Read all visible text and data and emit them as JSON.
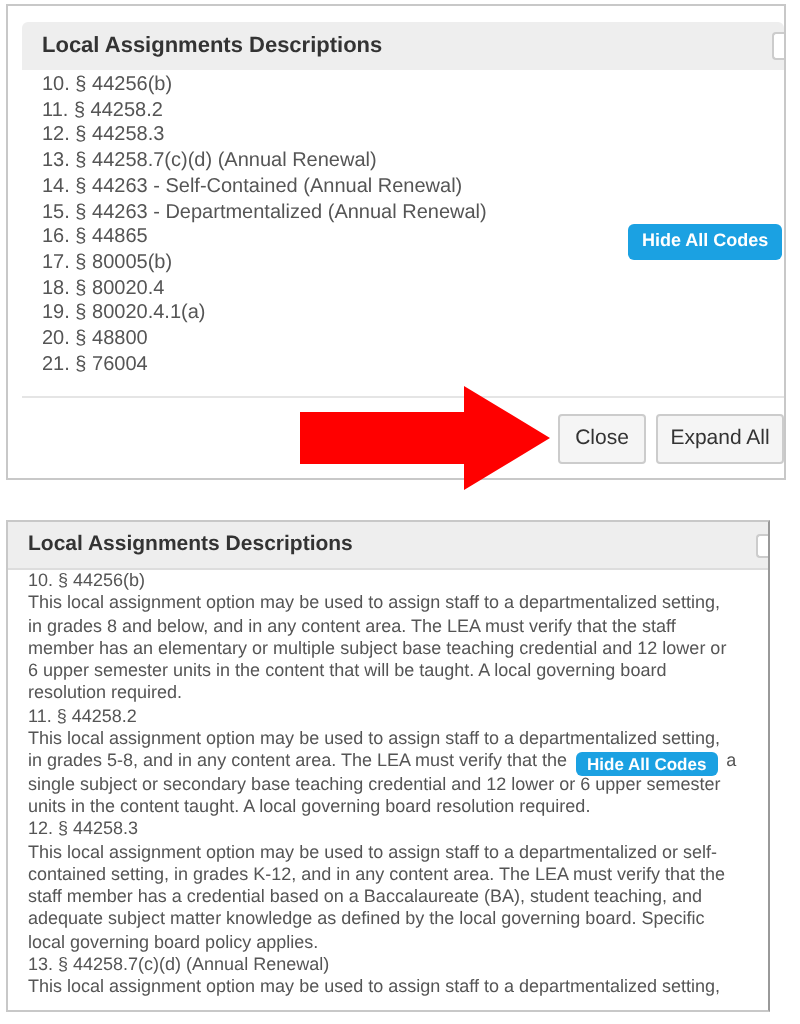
{
  "top_dialog": {
    "title": "Local Assignments Descriptions",
    "items": [
      "10. § 44256(b)",
      "11. § 44258.2",
      "12. § 44258.3",
      "13. § 44258.7(c)(d) (Annual Renewal)",
      "14. § 44263 - Self-Contained (Annual Renewal)",
      "15. § 44263 - Departmentalized (Annual Renewal)",
      "16. § 44865",
      "17. § 80005(b)",
      "18. § 80020.4",
      "19. § 80020.4.1(a)",
      "20. § 48800",
      "21. § 76004"
    ],
    "hide_button": "Hide All Codes",
    "buttons": [
      "Close",
      "Expand All"
    ]
  },
  "bottom_dialog": {
    "title": "Local Assignments Descriptions",
    "hide_button": "Hide All Codes",
    "entries": [
      {
        "heading": "10. § 44256(b)",
        "description": "This local assignment option may be used to assign staff to a departmentalized setting, in grades 8 and below, and in any content area. The LEA must verify that the staff member has an elementary or multiple subject base teaching credential and 12 lower or 6 upper semester units in the content that will be taught. A local governing board resolution required."
      },
      {
        "heading": "11. § 44258.2",
        "description": "This local assignment option may be used to assign staff to a departmentalized setting,",
        "line_before_button": "in grades 5-8, and in any content area. The LEA must verify that the",
        "line_after_button": "a",
        "description_continued": "single subject or secondary base teaching credential and 12 lower or 6 upper semester units in the content taught. A local governing board resolution required."
      },
      {
        "heading": "12. § 44258.3",
        "description": "This local assignment option may be used to assign staff to a departmentalized or self-contained setting, in grades K-12, and in any content area. The LEA must verify that the staff member has a credential based on a Baccalaureate (BA), student teaching, and adequate subject matter knowledge as defined by the local governing board. Specific local governing board policy applies."
      },
      {
        "heading": "13. § 44258.7(c)(d) (Annual Renewal)",
        "description": "This local assignment option may be used to assign staff to a departmentalized setting,"
      }
    ]
  }
}
